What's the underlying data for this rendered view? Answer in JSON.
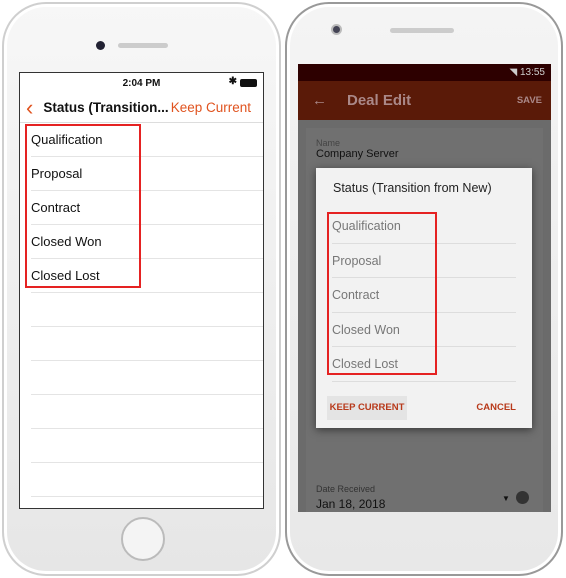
{
  "ios": {
    "time": "2:04 PM",
    "nav_title": "Status (Transition...",
    "keep_current": "Keep Current",
    "items": [
      "Qualification",
      "Proposal",
      "Contract",
      "Closed Won",
      "Closed Lost"
    ],
    "accent": "#e0531f"
  },
  "android": {
    "time": "13:55",
    "toolbar_title": "Deal Edit",
    "save": "SAVE",
    "name_label": "Name",
    "name_value": "Company Server",
    "dialog_title": "Status (Transition from New)",
    "items": [
      "Qualification",
      "Proposal",
      "Contract",
      "Closed Won",
      "Closed Lost"
    ],
    "keep_current": "KEEP CURRENT",
    "cancel": "CANCEL",
    "date_label": "Date Received",
    "date_value": "Jan 18, 2018",
    "accent": "#b8391a"
  },
  "highlight_color": "#e52222"
}
